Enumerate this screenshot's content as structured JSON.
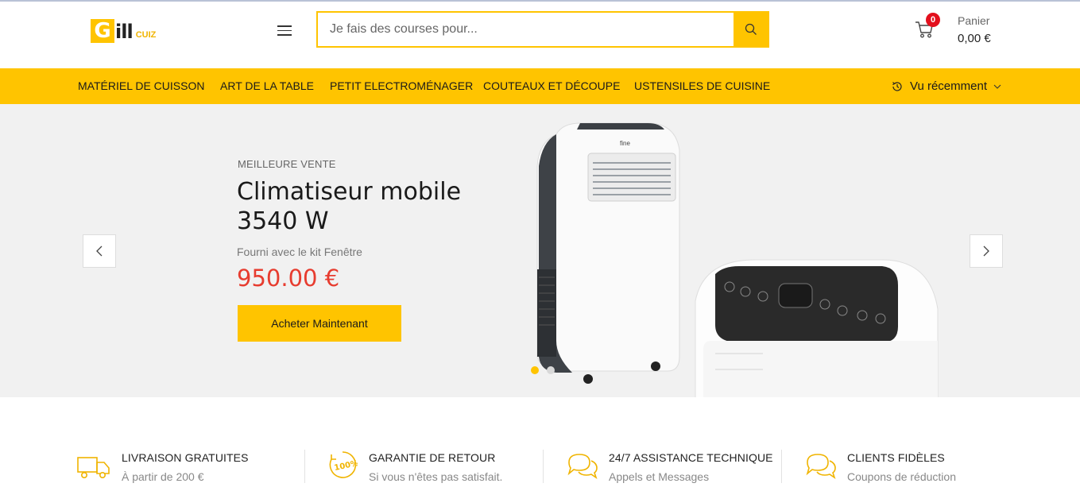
{
  "header": {
    "logo": {
      "initial": "G",
      "rest": "ill",
      "suffix": "CUIZ"
    },
    "search": {
      "placeholder": "Je fais des courses pour..."
    },
    "cart": {
      "count": "0",
      "label": "Panier",
      "total": "0,00 €"
    }
  },
  "nav": {
    "items": [
      {
        "label": "MATÉRIEL DE CUISSON"
      },
      {
        "label": "ART DE LA TABLE"
      },
      {
        "label": "PETIT ELECTROMÉNAGER"
      },
      {
        "label": "COUTEAUX ET DÉCOUPE"
      },
      {
        "label": "USTENSILES DE CUISINE"
      }
    ],
    "recent": "Vu récemment"
  },
  "hero": {
    "eyebrow": "MEILLEURE VENTE",
    "title": "Climatiseur mobile 3540 W",
    "subtitle": "Fourni avec le kit Fenêtre",
    "price": "950.00 €",
    "cta": "Acheter Maintenant",
    "active_slide": 1,
    "slide_count": 2
  },
  "features": [
    {
      "title": "LIVRAISON GRATUITES",
      "subtitle": "À partir de 200 €",
      "icon": "truck-icon"
    },
    {
      "title": "GARANTIE DE RETOUR",
      "subtitle": "Si vous n'êtes pas satisfait.",
      "icon": "guarantee-100-icon"
    },
    {
      "title": "24/7 ASSISTANCE TECHNIQUE",
      "subtitle": "Appels et Messages",
      "icon": "chat-bubbles-icon"
    },
    {
      "title": "CLIENTS FIDÈLES",
      "subtitle": "Coupons de réduction",
      "icon": "chat-bubbles-icon"
    }
  ],
  "colors": {
    "accent": "#ffc400",
    "price": "#e73c2f",
    "badge": "#e3101d",
    "hero_bg": "#f1f1f1"
  }
}
